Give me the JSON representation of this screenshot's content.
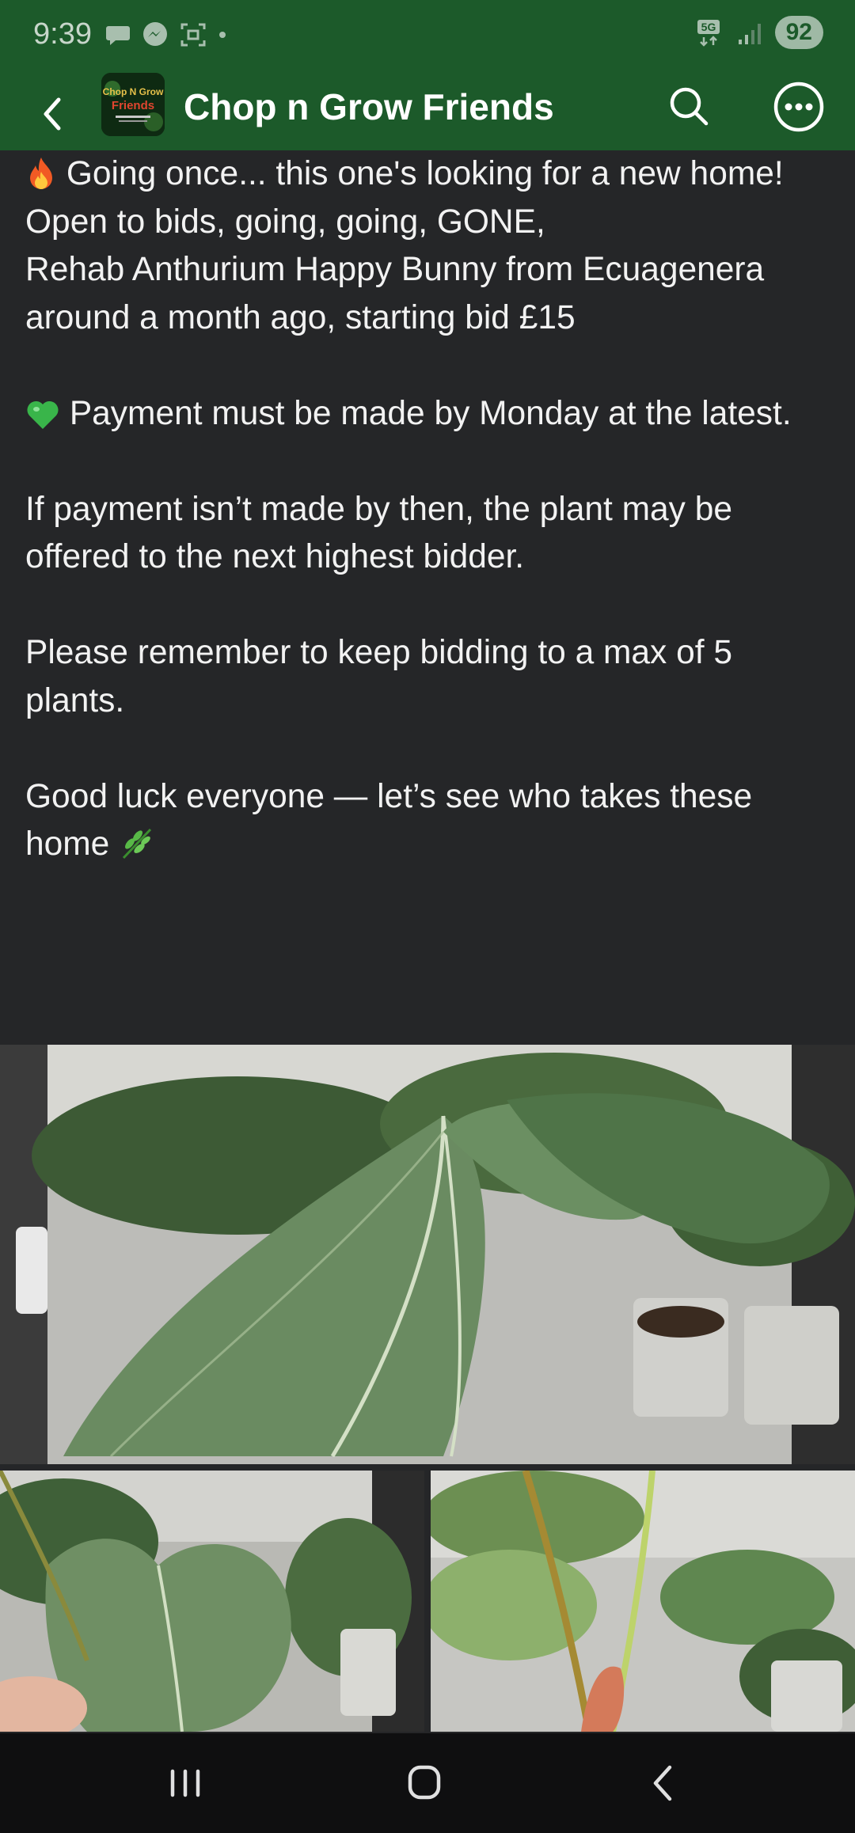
{
  "status_bar": {
    "time": "9:39",
    "network": "5G",
    "battery": "92"
  },
  "header": {
    "title": "Chop n Grow Friends",
    "avatar_lines": [
      "Chop N Grow",
      "Friends"
    ]
  },
  "post": {
    "line1": "Going once... this one's looking for a new home!",
    "line2": "Open to bids, going, going, GONE,",
    "line3": "Rehab Anthurium Happy Bunny from Ecuagenera around a month ago, starting bid £15",
    "payment": "Payment must be made by Monday at the latest.",
    "warning": "If payment isn’t made by then, the plant may be offered to the next highest bidder.",
    "reminder": "Please remember to keep bidding to a max of 5 plants.",
    "closing": "Good luck everyone — let’s see who takes these home"
  },
  "icons": {
    "fire": "fire-icon",
    "green_heart": "green-heart-icon",
    "herb": "herb-icon",
    "back": "back-arrow-icon",
    "search": "search-icon",
    "more": "more-options-icon"
  },
  "colors": {
    "header_bg": "#1c5a2a",
    "content_bg": "#252628",
    "nav_bg": "#0f0f10"
  }
}
